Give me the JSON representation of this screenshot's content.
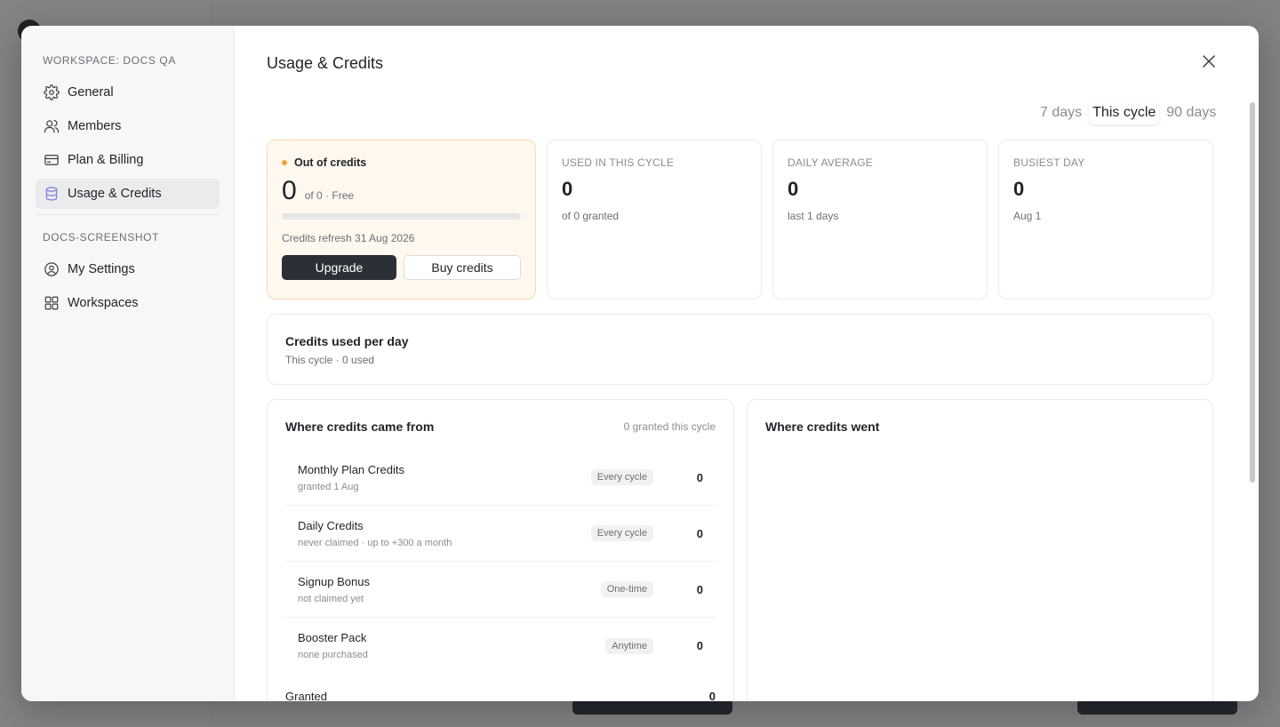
{
  "modal": {
    "title": "Usage & Credits",
    "close_icon": "close-icon"
  },
  "sidebar": {
    "section1": "WORKSPACE: DOCS QA",
    "items1": [
      {
        "label": "General",
        "icon": "gear-icon"
      },
      {
        "label": "Members",
        "icon": "users-icon"
      },
      {
        "label": "Plan & Billing",
        "icon": "credit-card-icon"
      },
      {
        "label": "Usage & Credits",
        "icon": "database-icon",
        "active": true
      }
    ],
    "section2": "DOCS-SCREENSHOT",
    "items2": [
      {
        "label": "My Settings",
        "icon": "user-circle-icon"
      },
      {
        "label": "Workspaces",
        "icon": "grid-icon"
      }
    ]
  },
  "range": {
    "tabs": [
      "7 days",
      "This cycle",
      "90 days"
    ],
    "selected": "This cycle"
  },
  "status": {
    "label": "Out of credits",
    "value": "0",
    "of": "of 0 · Free",
    "progress": 0,
    "refresh": "Credits refresh 31 Aug 2026",
    "upgrade": "Upgrade",
    "buy": "Buy credits",
    "accent": "#f2a33a"
  },
  "stats": [
    {
      "label": "USED IN THIS CYCLE",
      "value": "0",
      "sub": "of 0 granted"
    },
    {
      "label": "DAILY AVERAGE",
      "value": "0",
      "sub": "last 1 days"
    },
    {
      "label": "BUSIEST DAY",
      "value": "0",
      "sub": "Aug 1"
    }
  ],
  "per_day": {
    "title": "Credits used per day",
    "sub": "This cycle · 0 used"
  },
  "from": {
    "title": "Where credits came from",
    "right": "0 granted this cycle",
    "rows": [
      {
        "name": "Monthly Plan Credits",
        "meta": "granted 1 Aug",
        "pill": "Every cycle",
        "value": "0"
      },
      {
        "name": "Daily Credits",
        "meta": "never claimed · up to +300 a month",
        "pill": "Every cycle",
        "value": "0"
      },
      {
        "name": "Signup Bonus",
        "meta": "not claimed yet",
        "pill": "One-time",
        "value": "0"
      },
      {
        "name": "Booster Pack",
        "meta": "none purchased",
        "pill": "Anytime",
        "value": "0"
      }
    ],
    "granted_label": "Granted",
    "granted_value": "0"
  },
  "went": {
    "title": "Where credits went"
  }
}
